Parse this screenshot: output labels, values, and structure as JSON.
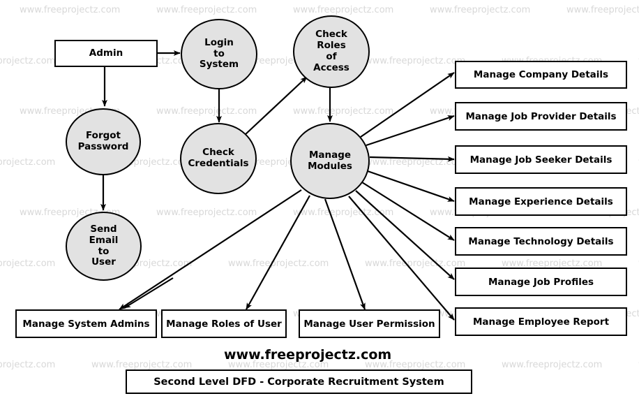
{
  "diagram": {
    "title": "Second Level DFD - Corporate Recruitment System",
    "brand": "www.freeprojectz.com",
    "watermark_text": "www.freeprojectz.com",
    "colors": {
      "process_fill": "#e2e2e2",
      "entity_fill": "#ffffff",
      "stroke": "#000000",
      "watermark": "#d8d8d8",
      "background": "#ffffff"
    },
    "external_entities": [
      {
        "id": "admin",
        "label": "Admin"
      }
    ],
    "processes": [
      {
        "id": "login_to_system",
        "label": "Login to System"
      },
      {
        "id": "check_roles_of_access",
        "label": "Check Roles of Access"
      },
      {
        "id": "forgot_password",
        "label": "Forgot Password"
      },
      {
        "id": "check_credentials",
        "label": "Check Credentials"
      },
      {
        "id": "manage_modules",
        "label": "Manage Modules"
      },
      {
        "id": "send_email_to_user",
        "label": "Send Email to User"
      }
    ],
    "right_outputs": [
      {
        "id": "manage_company_details",
        "label": "Manage Company Details"
      },
      {
        "id": "manage_job_provider_details",
        "label": "Manage Job Provider Details"
      },
      {
        "id": "manage_job_seeker_details",
        "label": "Manage Job Seeker Details"
      },
      {
        "id": "manage_experience_details",
        "label": "Manage Experience Details"
      },
      {
        "id": "manage_technology_details",
        "label": "Manage Technology Details"
      },
      {
        "id": "manage_job_profiles",
        "label": "Manage Job Profiles"
      },
      {
        "id": "manage_employee_report",
        "label": "Manage Employee Report"
      }
    ],
    "bottom_outputs": [
      {
        "id": "manage_system_admins",
        "label": "Manage System Admins"
      },
      {
        "id": "manage_roles_of_user",
        "label": "Manage Roles of User"
      },
      {
        "id": "manage_user_permission",
        "label": "Manage User Permission"
      }
    ],
    "node_text_lines": {
      "admin": [
        "Admin"
      ],
      "login_to_system": [
        "Login",
        "to",
        "System"
      ],
      "check_roles_of_access": [
        "Check",
        "Roles",
        "of",
        "Access"
      ],
      "forgot_password": [
        "Forgot",
        "Password"
      ],
      "check_credentials": [
        "Check",
        "Credentials"
      ],
      "manage_modules": [
        "Manage",
        "Modules"
      ],
      "send_email_to_user": [
        "Send",
        "Email",
        "to",
        "User"
      ]
    },
    "flows": [
      {
        "from": "admin",
        "to": "login_to_system"
      },
      {
        "from": "admin",
        "to": "forgot_password"
      },
      {
        "from": "forgot_password",
        "to": "send_email_to_user"
      },
      {
        "from": "login_to_system",
        "to": "check_credentials"
      },
      {
        "from": "check_credentials",
        "to": "check_roles_of_access"
      },
      {
        "from": "check_roles_of_access",
        "to": "manage_modules"
      },
      {
        "from": "manage_modules",
        "to": "manage_company_details"
      },
      {
        "from": "manage_modules",
        "to": "manage_job_provider_details"
      },
      {
        "from": "manage_modules",
        "to": "manage_job_seeker_details"
      },
      {
        "from": "manage_modules",
        "to": "manage_experience_details"
      },
      {
        "from": "manage_modules",
        "to": "manage_technology_details"
      },
      {
        "from": "manage_modules",
        "to": "manage_job_profiles"
      },
      {
        "from": "manage_modules",
        "to": "manage_employee_report"
      },
      {
        "from": "manage_modules",
        "to": "manage_system_admins"
      },
      {
        "from": "manage_modules",
        "to": "manage_roles_of_user"
      },
      {
        "from": "manage_modules",
        "to": "manage_user_permission"
      },
      {
        "from": "send_email_to_user",
        "to": "manage_system_admins"
      }
    ]
  }
}
